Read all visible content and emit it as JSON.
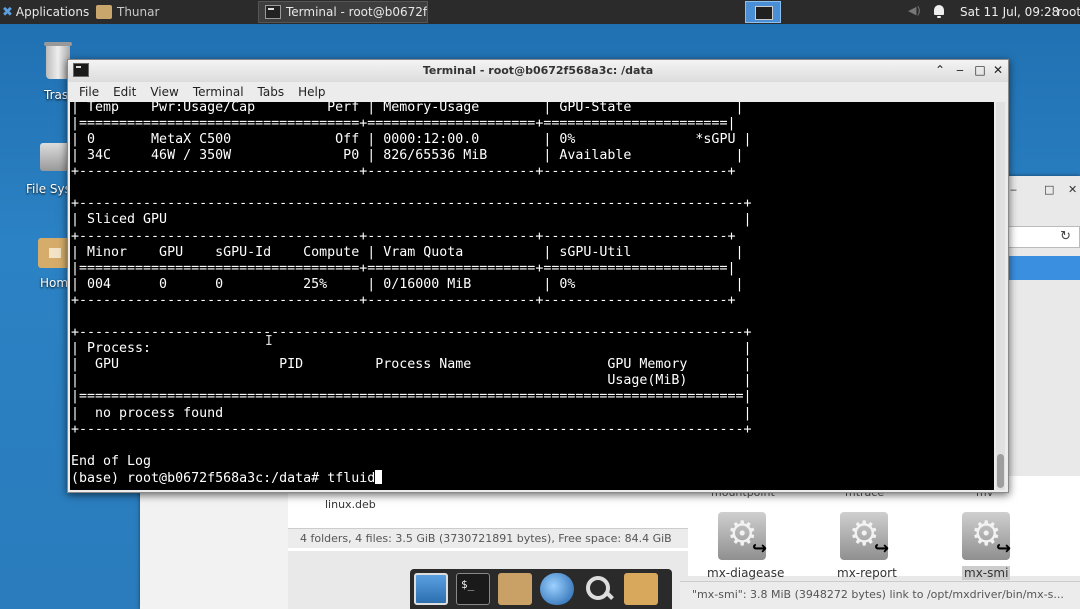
{
  "panel": {
    "applications_label": "Applications",
    "tasks": [
      {
        "label": "Thunar"
      },
      {
        "label": "Terminal - root@b0672f..."
      }
    ],
    "clock": "Sat 11 Jul, 09:28",
    "user": "root"
  },
  "desktop": {
    "icons": [
      {
        "label": "Tras"
      },
      {
        "label": "File Sys"
      },
      {
        "label": "Hom"
      }
    ]
  },
  "thunar": {
    "file_a": "linux.deb",
    "status_left": "4 folders, 4 files: 3.5 GiB (3730721891 bytes), Free space: 84.4 GiB",
    "top_labels": [
      "mountpoint",
      "mtrace",
      "mv"
    ],
    "icons": [
      {
        "label": "mx-diagease"
      },
      {
        "label": "mx-report"
      },
      {
        "label": "mx-smi"
      }
    ],
    "status_right": "\"mx-smi\": 3.8 MiB (3948272 bytes) link to /opt/mxdriver/bin/mx-s..."
  },
  "terminal": {
    "title": "Terminal - root@b0672f568a3c: /data",
    "menu": [
      "File",
      "Edit",
      "View",
      "Terminal",
      "Tabs",
      "Help"
    ],
    "output": "| Temp    Pwr:Usage/Cap         Perf | Memory-Usage        | GPU-State             |\n|===================================+=====================+=======================|\n| 0       MetaX C500             Off | 0000:12:00.0        | 0%               *sGPU |\n| 34C     46W / 350W              P0 | 826/65536 MiB       | Available             |\n+-----------------------------------+---------------------+-----------------------+\n\n+-----------------------------------------------------------------------------------+\n| Sliced GPU                                                                        |\n+-----------------------------------+---------------------+-----------------------+\n| Minor    GPU    sGPU-Id    Compute | Vram Quota          | sGPU-Util             |\n|===================================+=====================+=======================|\n| 004      0      0          25%     | 0/16000 MiB         | 0%                    |\n+-----------------------------------+---------------------+-----------------------+\n\n+-----------------------------------------------------------------------------------+\n| Process:                                                                          |\n|  GPU                    PID         Process Name                 GPU Memory       |\n|                                                                  Usage(MiB)       |\n|===================================================================================|\n|  no process found                                                                 |\n+-----------------------------------------------------------------------------------+\n\nEnd of Log",
    "prompt": "(base) root@b0672f568a3c:/data# ",
    "command": "tfluid"
  }
}
